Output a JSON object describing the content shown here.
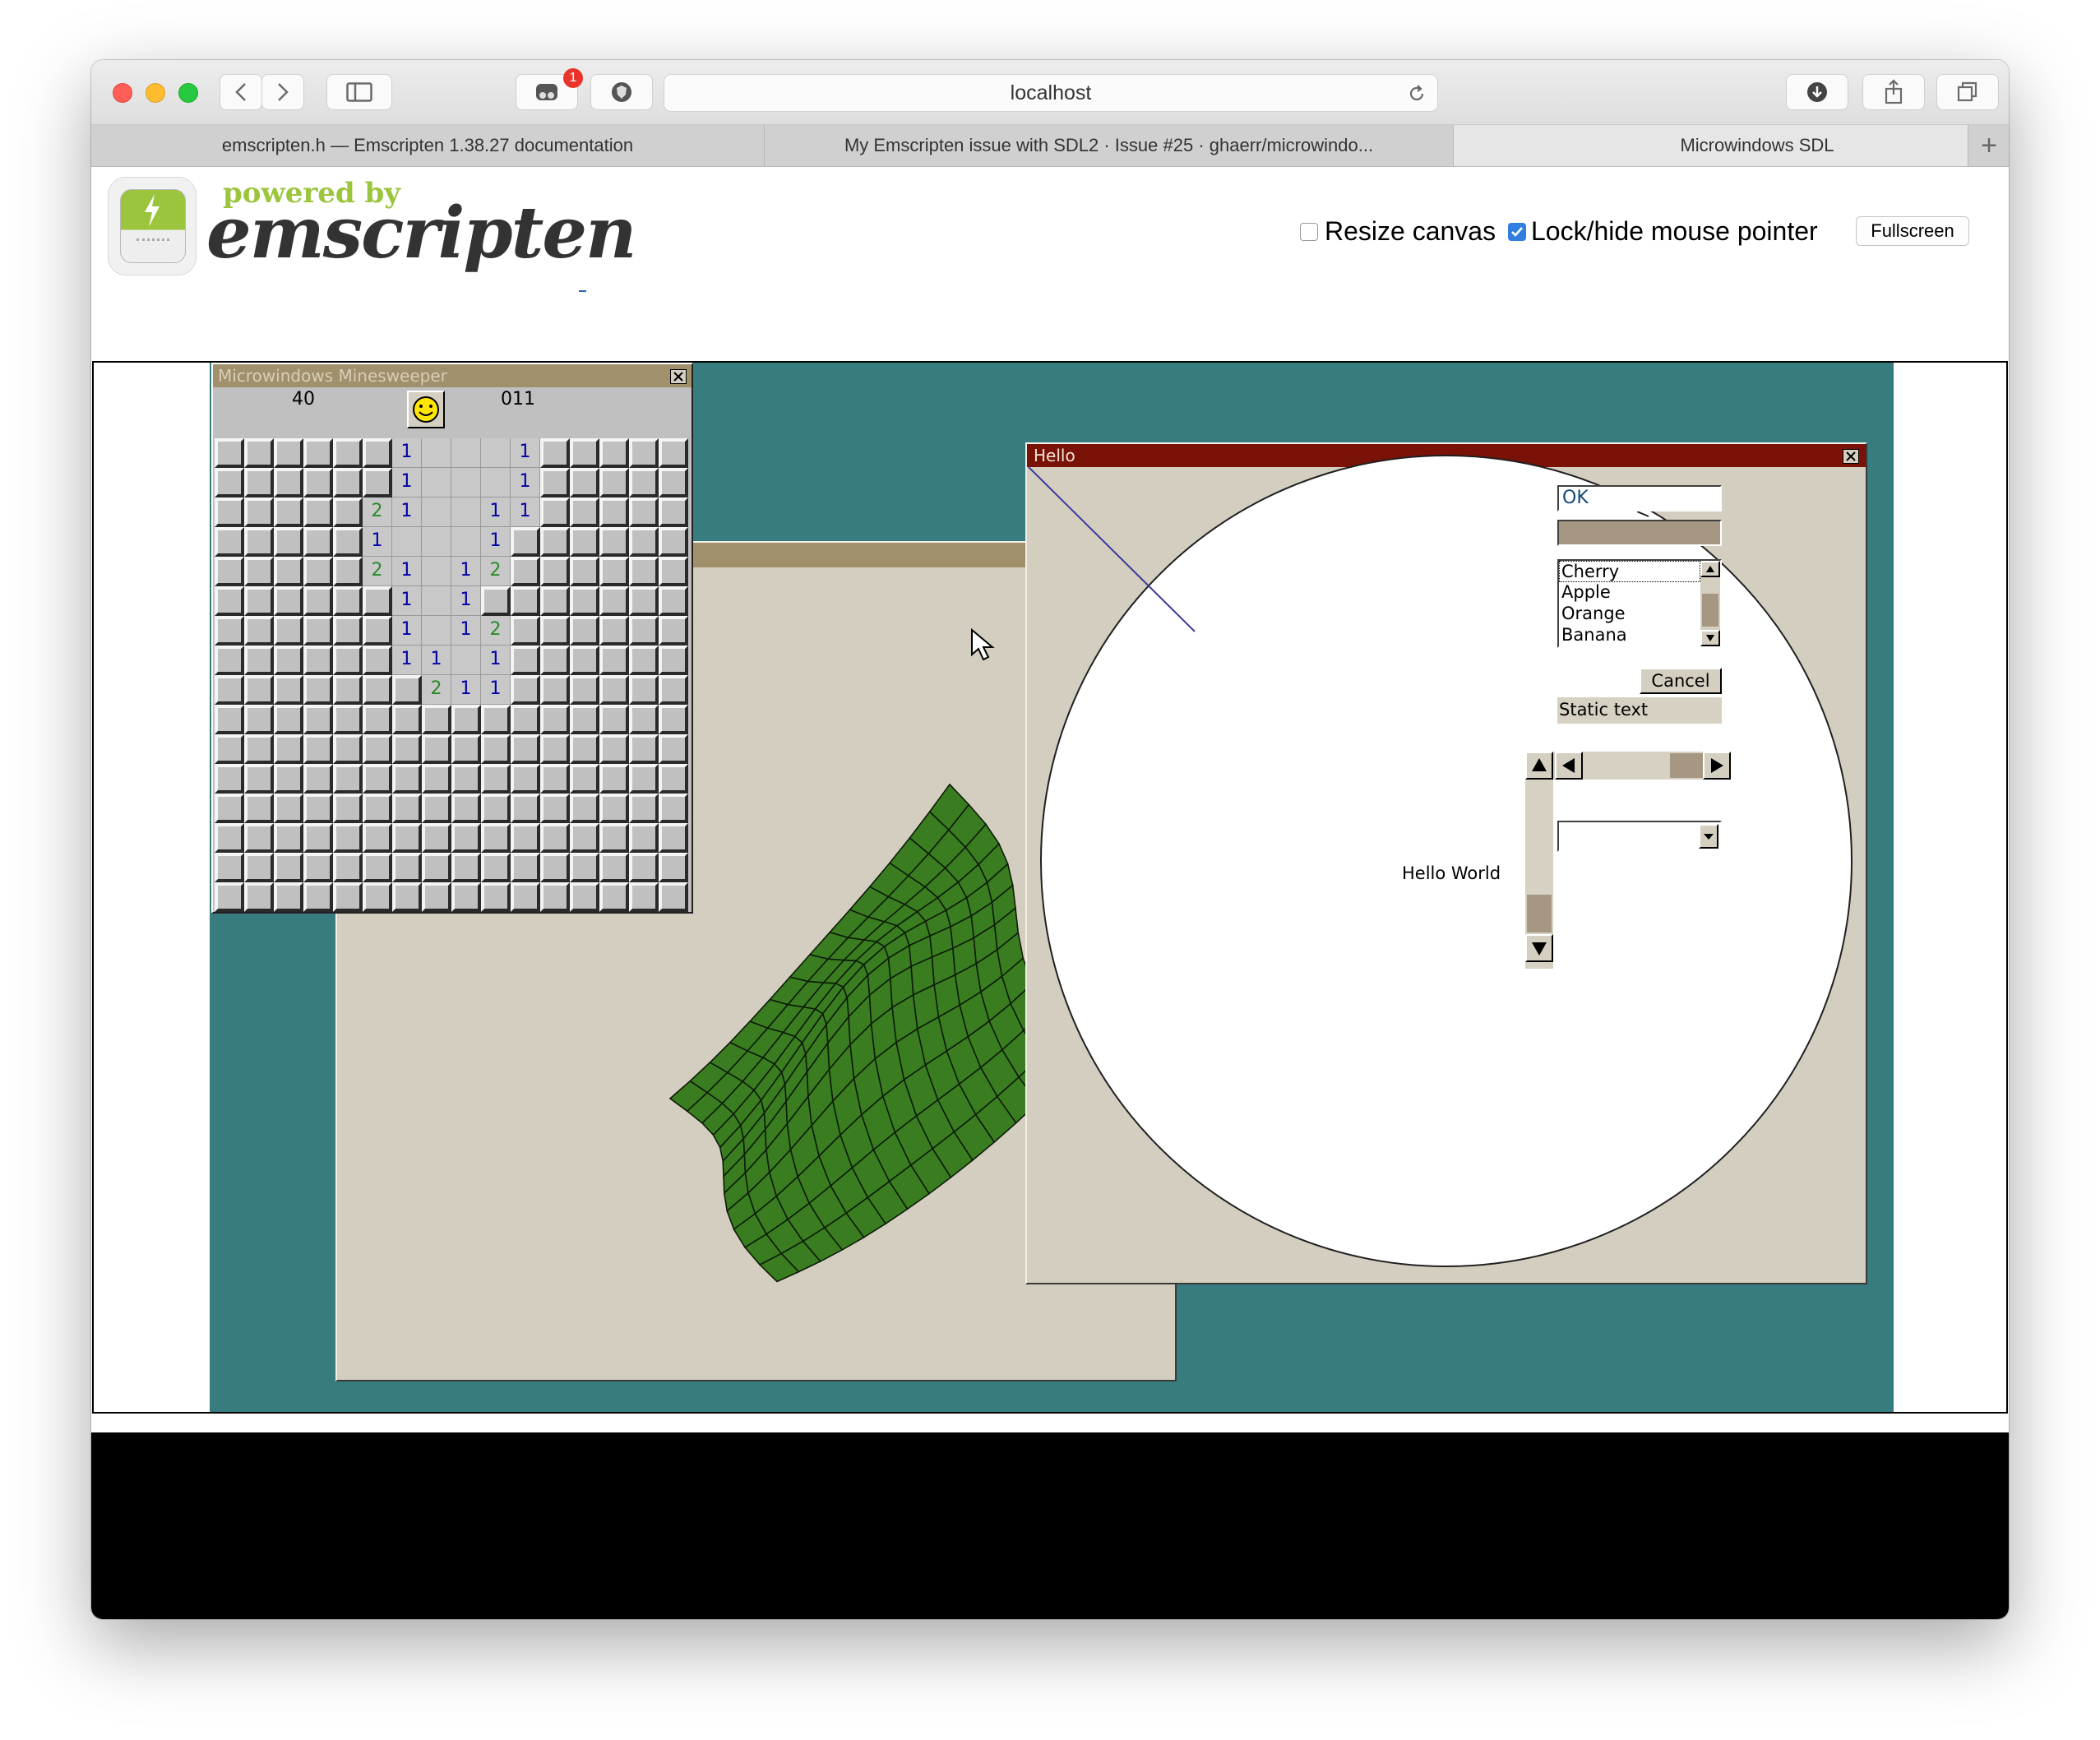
{
  "browser": {
    "url": "localhost",
    "notification_badge": "1",
    "tabs": [
      {
        "label": "emscripten.h — Emscripten 1.38.27 documentation",
        "active": false
      },
      {
        "label": "My Emscripten issue with SDL2 · Issue #25 · ghaerr/microwindo...",
        "active": false
      },
      {
        "label": "Microwindows SDL",
        "active": true
      }
    ],
    "new_tab": "+"
  },
  "header": {
    "logo_top": "powered by",
    "logo_bottom": "emscripten",
    "resize_canvas_label": "Resize canvas",
    "resize_canvas_checked": false,
    "lock_mouse_label": "Lock/hide mouse pointer",
    "lock_mouse_checked": true,
    "fullscreen_label": "Fullscreen"
  },
  "minesweeper": {
    "title": "Microwindows Minesweeper",
    "mines_left": "40",
    "timer": "011",
    "face": "☺",
    "grid_size": [
      16,
      16
    ],
    "revealed": [
      {
        "r": 0,
        "c": 6,
        "v": "1"
      },
      {
        "r": 0,
        "c": 7,
        "v": ""
      },
      {
        "r": 0,
        "c": 8,
        "v": ""
      },
      {
        "r": 0,
        "c": 9,
        "v": ""
      },
      {
        "r": 0,
        "c": 10,
        "v": "1"
      },
      {
        "r": 1,
        "c": 6,
        "v": "1"
      },
      {
        "r": 1,
        "c": 7,
        "v": ""
      },
      {
        "r": 1,
        "c": 8,
        "v": ""
      },
      {
        "r": 1,
        "c": 9,
        "v": ""
      },
      {
        "r": 1,
        "c": 10,
        "v": "1"
      },
      {
        "r": 2,
        "c": 5,
        "v": "2"
      },
      {
        "r": 2,
        "c": 6,
        "v": "1"
      },
      {
        "r": 2,
        "c": 7,
        "v": ""
      },
      {
        "r": 2,
        "c": 8,
        "v": ""
      },
      {
        "r": 2,
        "c": 9,
        "v": "1"
      },
      {
        "r": 2,
        "c": 10,
        "v": "1"
      },
      {
        "r": 3,
        "c": 5,
        "v": "1"
      },
      {
        "r": 3,
        "c": 6,
        "v": ""
      },
      {
        "r": 3,
        "c": 7,
        "v": ""
      },
      {
        "r": 3,
        "c": 8,
        "v": ""
      },
      {
        "r": 3,
        "c": 9,
        "v": "1"
      },
      {
        "r": 4,
        "c": 5,
        "v": "2"
      },
      {
        "r": 4,
        "c": 6,
        "v": "1"
      },
      {
        "r": 4,
        "c": 7,
        "v": ""
      },
      {
        "r": 4,
        "c": 8,
        "v": "1"
      },
      {
        "r": 4,
        "c": 9,
        "v": "2"
      },
      {
        "r": 5,
        "c": 6,
        "v": "1"
      },
      {
        "r": 5,
        "c": 7,
        "v": ""
      },
      {
        "r": 5,
        "c": 8,
        "v": "1"
      },
      {
        "r": 6,
        "c": 6,
        "v": "1"
      },
      {
        "r": 6,
        "c": 7,
        "v": ""
      },
      {
        "r": 6,
        "c": 8,
        "v": "1"
      },
      {
        "r": 6,
        "c": 9,
        "v": "2"
      },
      {
        "r": 7,
        "c": 6,
        "v": "1"
      },
      {
        "r": 7,
        "c": 7,
        "v": "1"
      },
      {
        "r": 7,
        "c": 8,
        "v": ""
      },
      {
        "r": 7,
        "c": 9,
        "v": "1"
      },
      {
        "r": 8,
        "c": 7,
        "v": "2"
      },
      {
        "r": 8,
        "c": 8,
        "v": "1"
      },
      {
        "r": 8,
        "c": 9,
        "v": "1"
      }
    ]
  },
  "hello_window": {
    "title": "Hello",
    "edit_value": "OK",
    "list_items": [
      "Cherry",
      "Apple",
      "Orange",
      "Banana"
    ],
    "cancel_label": "Cancel",
    "static_text": "Static text",
    "hello_world": "Hello World",
    "combo_value": ""
  },
  "colors": {
    "desktop": "#377d80",
    "hello_titlebar": "#7a1208",
    "minesweeper_titlebar": "#a0906c",
    "window_face": "#d4cfc0",
    "mesh_green": "#3a7d20",
    "mine_number_blue": "#0000a8",
    "mine_number_green": "#2a8a2a"
  },
  "icons": {
    "close": "close-icon",
    "scroll_up": "arrow-up-icon",
    "scroll_down": "arrow-down-icon",
    "scroll_left": "arrow-left-icon",
    "scroll_right": "arrow-right-icon",
    "combo_dropdown": "chevron-down-icon"
  }
}
